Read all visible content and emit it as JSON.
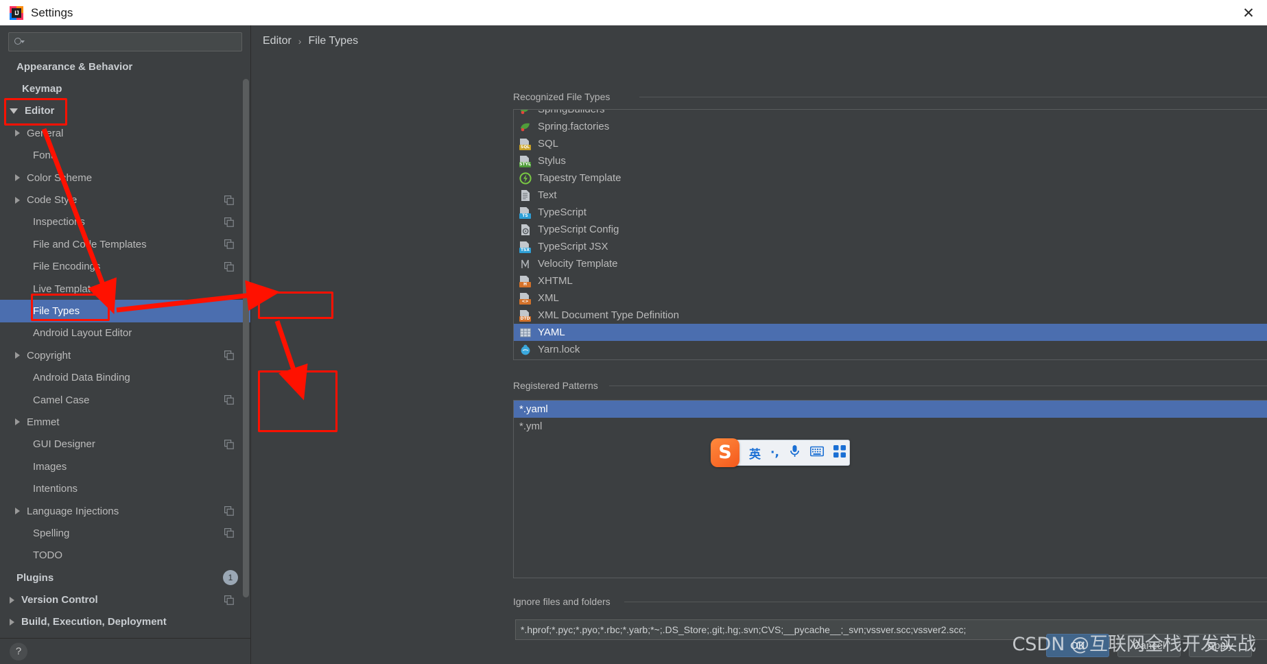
{
  "window": {
    "title": "Settings",
    "logo_text": "IJ",
    "close_label": "✕"
  },
  "search": {
    "value": "",
    "placeholder": "",
    "icon": "search-icon"
  },
  "sidebar": {
    "items": [
      {
        "label": "Appearance & Behavior",
        "indent": 0,
        "arrow": "none",
        "bold": true,
        "selected": false,
        "trailing": "none"
      },
      {
        "label": "Keymap",
        "indent": 1,
        "arrow": "none",
        "bold": true,
        "selected": false,
        "trailing": "none"
      },
      {
        "label": "Editor",
        "indent": 0,
        "arrow": "down",
        "bold": true,
        "selected": false,
        "trailing": "none"
      },
      {
        "label": "General",
        "indent": 1,
        "arrow": "right",
        "bold": false,
        "selected": false,
        "trailing": "none"
      },
      {
        "label": "Font",
        "indent": 2,
        "arrow": "none",
        "bold": false,
        "selected": false,
        "trailing": "none"
      },
      {
        "label": "Color Scheme",
        "indent": 1,
        "arrow": "right",
        "bold": false,
        "selected": false,
        "trailing": "none"
      },
      {
        "label": "Code Style",
        "indent": 1,
        "arrow": "right",
        "bold": false,
        "selected": false,
        "trailing": "copy"
      },
      {
        "label": "Inspections",
        "indent": 2,
        "arrow": "none",
        "bold": false,
        "selected": false,
        "trailing": "copy"
      },
      {
        "label": "File and Code Templates",
        "indent": 2,
        "arrow": "none",
        "bold": false,
        "selected": false,
        "trailing": "copy"
      },
      {
        "label": "File Encodings",
        "indent": 2,
        "arrow": "none",
        "bold": false,
        "selected": false,
        "trailing": "copy"
      },
      {
        "label": "Live Templates",
        "indent": 2,
        "arrow": "none",
        "bold": false,
        "selected": false,
        "trailing": "none"
      },
      {
        "label": "File Types",
        "indent": 2,
        "arrow": "none",
        "bold": false,
        "selected": true,
        "trailing": "none"
      },
      {
        "label": "Android Layout Editor",
        "indent": 2,
        "arrow": "none",
        "bold": false,
        "selected": false,
        "trailing": "none"
      },
      {
        "label": "Copyright",
        "indent": 1,
        "arrow": "right",
        "bold": false,
        "selected": false,
        "trailing": "copy"
      },
      {
        "label": "Android Data Binding",
        "indent": 2,
        "arrow": "none",
        "bold": false,
        "selected": false,
        "trailing": "none"
      },
      {
        "label": "Camel Case",
        "indent": 2,
        "arrow": "none",
        "bold": false,
        "selected": false,
        "trailing": "copy"
      },
      {
        "label": "Emmet",
        "indent": 1,
        "arrow": "right",
        "bold": false,
        "selected": false,
        "trailing": "none"
      },
      {
        "label": "GUI Designer",
        "indent": 2,
        "arrow": "none",
        "bold": false,
        "selected": false,
        "trailing": "copy"
      },
      {
        "label": "Images",
        "indent": 2,
        "arrow": "none",
        "bold": false,
        "selected": false,
        "trailing": "none"
      },
      {
        "label": "Intentions",
        "indent": 2,
        "arrow": "none",
        "bold": false,
        "selected": false,
        "trailing": "none"
      },
      {
        "label": "Language Injections",
        "indent": 1,
        "arrow": "right",
        "bold": false,
        "selected": false,
        "trailing": "copy"
      },
      {
        "label": "Spelling",
        "indent": 2,
        "arrow": "none",
        "bold": false,
        "selected": false,
        "trailing": "copy"
      },
      {
        "label": "TODO",
        "indent": 2,
        "arrow": "none",
        "bold": false,
        "selected": false,
        "trailing": "none"
      },
      {
        "label": "Plugins",
        "indent": 0,
        "arrow": "none",
        "bold": true,
        "selected": false,
        "trailing": "badge",
        "badge": "1"
      },
      {
        "label": "Version Control",
        "indent": 0,
        "arrow": "right",
        "bold": true,
        "selected": false,
        "trailing": "copy"
      },
      {
        "label": "Build, Execution, Deployment",
        "indent": 0,
        "arrow": "right",
        "bold": true,
        "selected": false,
        "trailing": "none"
      }
    ],
    "help_button": "?"
  },
  "breadcrumb": {
    "parent": "Editor",
    "separator": "›",
    "current": "File Types"
  },
  "recognized": {
    "group_label": "Recognized File Types",
    "items": [
      {
        "label": "SpringBuilders",
        "icon": "spring-icon",
        "tag": "",
        "tag_color": "#6aa84f",
        "selected": false,
        "clipped": true
      },
      {
        "label": "Spring.factories",
        "icon": "spring-icon",
        "tag": "",
        "tag_color": "#6aa84f",
        "selected": false
      },
      {
        "label": "SQL",
        "icon": "file-tag-icon",
        "tag": "SQL",
        "tag_color": "#c9a227",
        "selected": false
      },
      {
        "label": "Stylus",
        "icon": "file-tag-icon",
        "tag": "STYL",
        "tag_color": "#4f9d3a",
        "selected": false
      },
      {
        "label": "Tapestry Template",
        "icon": "tapestry-icon",
        "tag": "",
        "tag_color": "#7ac943",
        "selected": false
      },
      {
        "label": "Text",
        "icon": "text-file-icon",
        "tag": "",
        "tag_color": "#9aa0a6",
        "selected": false
      },
      {
        "label": "TypeScript",
        "icon": "file-tag-icon",
        "tag": "TS",
        "tag_color": "#2e9fd6",
        "selected": false
      },
      {
        "label": "TypeScript Config",
        "icon": "ts-config-icon",
        "tag": "",
        "tag_color": "#9aa0a6",
        "selected": false
      },
      {
        "label": "TypeScript JSX",
        "icon": "file-tag-icon",
        "tag": "TSX",
        "tag_color": "#2e9fd6",
        "selected": false
      },
      {
        "label": "Velocity Template",
        "icon": "velocity-icon",
        "tag": "",
        "tag_color": "#b0b4b8",
        "selected": false
      },
      {
        "label": "XHTML",
        "icon": "file-tag-icon",
        "tag": "H",
        "tag_color": "#d4722a",
        "selected": false
      },
      {
        "label": "XML",
        "icon": "file-tag-icon",
        "tag": "<>",
        "tag_color": "#d4722a",
        "selected": false
      },
      {
        "label": "XML Document Type Definition",
        "icon": "file-tag-icon",
        "tag": "DTD",
        "tag_color": "#d4722a",
        "selected": false
      },
      {
        "label": "YAML",
        "icon": "yaml-grid-icon",
        "tag": "",
        "tag_color": "#8fa8c8",
        "selected": true
      },
      {
        "label": "Yarn.lock",
        "icon": "yarn-icon",
        "tag": "",
        "tag_color": "#3aa8dd",
        "selected": false
      }
    ],
    "toolbar": [
      {
        "name": "add",
        "glyph": "+",
        "enabled": true
      },
      {
        "name": "remove",
        "glyph": "−",
        "enabled": false
      },
      {
        "name": "edit",
        "glyph": "pencil",
        "enabled": false
      }
    ]
  },
  "patterns": {
    "group_label": "Registered Patterns",
    "items": [
      {
        "label": "*.yaml",
        "selected": true
      },
      {
        "label": "*.yml",
        "selected": false
      }
    ],
    "toolbar": [
      {
        "name": "add",
        "glyph": "+",
        "enabled": true
      },
      {
        "name": "remove",
        "glyph": "−",
        "enabled": true
      },
      {
        "name": "edit",
        "glyph": "pencil",
        "enabled": true
      }
    ]
  },
  "ignore": {
    "group_label": "Ignore files and folders",
    "value": "*.hprof;*.pyc;*.pyo;*.rbc;*.yarb;*~;.DS_Store;.git;.hg;.svn;CVS;__pycache__;_svn;vssver.scc;vssver2.scc;"
  },
  "footer": {
    "ok": "OK",
    "cancel": "Cancel",
    "apply": "Apply"
  },
  "ime": {
    "logo": "S",
    "mode": "英",
    "punctuation": "·,",
    "mic": "microphone-icon",
    "keyboard": "keyboard-icon",
    "apps": "apps-grid-icon"
  },
  "watermark": "CSDN @互联网全栈开发实战",
  "colors": {
    "selection": "#4b6eaf",
    "annotation": "#ff1100",
    "panel_bg": "#3c3f41",
    "primary_button": "#41658a"
  }
}
